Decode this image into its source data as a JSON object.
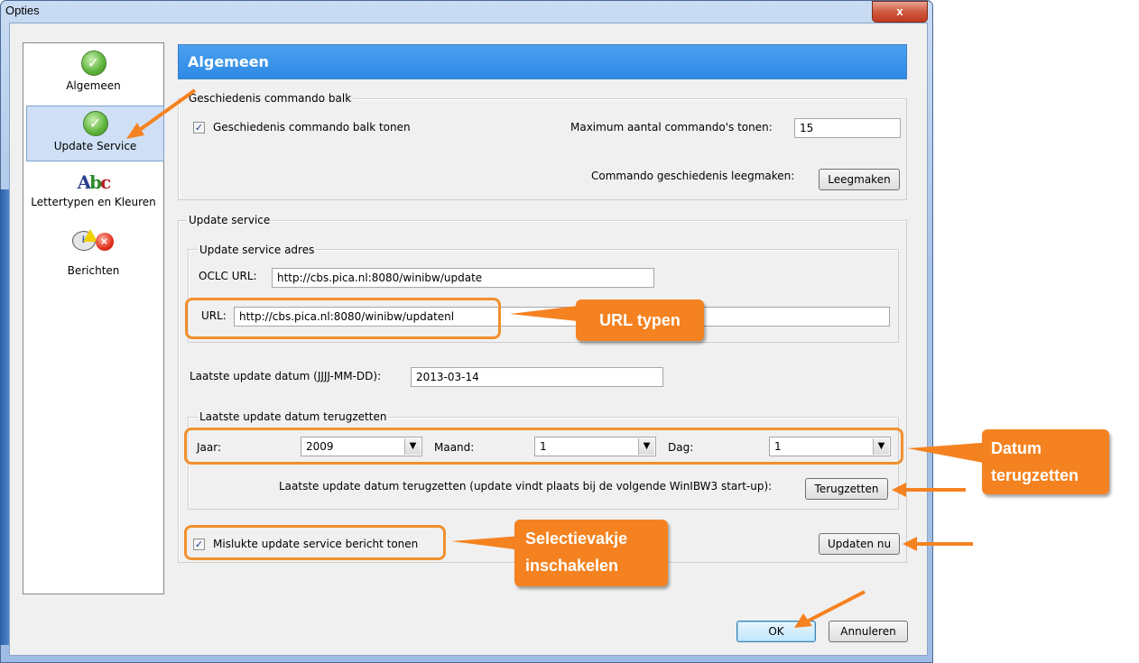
{
  "window": {
    "title": "Opties",
    "close_label": "x"
  },
  "sidebar": {
    "items": [
      {
        "label": "Algemeen",
        "icon": "check-icon"
      },
      {
        "label": "Update Service",
        "icon": "check-icon",
        "selected": true
      },
      {
        "label": "Lettertypen en Kleuren",
        "icon": "font-color-icon"
      },
      {
        "label": "Berichten",
        "icon": "messages-icon"
      }
    ]
  },
  "header": {
    "title": "Algemeen"
  },
  "history": {
    "legend": "Geschiedenis commando balk",
    "show_label": "Geschiedenis commando balk tonen",
    "show_checked": true,
    "max_label": "Maximum aantal commando's tonen:",
    "max_value": "15",
    "clear_label": "Commando geschiedenis leegmaken:",
    "clear_button": "Leegmaken"
  },
  "update": {
    "legend": "Update service",
    "address_legend": "Update service adres",
    "oclc_label": "OCLC URL:",
    "oclc_value": "http://cbs.pica.nl:8080/winibw/update",
    "url_label": "URL:",
    "url_value": "http://cbs.pica.nl:8080/winibw/updatenl",
    "last_date_label": "Laatste update datum (JJJJ-MM-DD):",
    "last_date_value": "2013-03-14",
    "reset_legend": "Laatste update datum terugzetten",
    "year_label": "Jaar:",
    "year_value": "2009",
    "month_label": "Maand:",
    "month_value": "1",
    "day_label": "Dag:",
    "day_value": "1",
    "reset_note": "Laatste update datum terugzetten (update vindt plaats bij de volgende WinIBW3 start-up):",
    "reset_button": "Terugzetten",
    "failed_label": "Mislukte update service bericht tonen",
    "failed_checked": true,
    "update_now_button": "Updaten nu"
  },
  "footer": {
    "ok": "OK",
    "cancel": "Annuleren"
  },
  "callouts": {
    "url": "URL typen",
    "date_line1": "Datum",
    "date_line2": "terugzetten",
    "checkbox_line1": "Selectievakje",
    "checkbox_line2": "inschakelen"
  },
  "colors": {
    "accent": "#f58220",
    "header": "#3b93ea"
  }
}
